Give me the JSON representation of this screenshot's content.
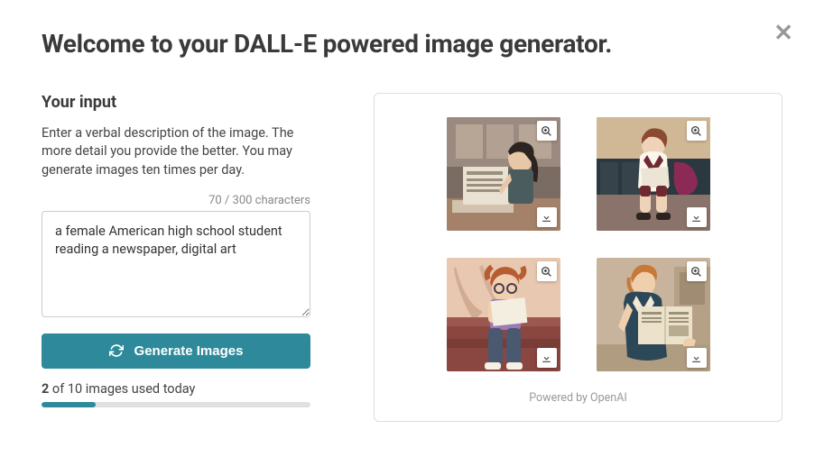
{
  "header": {
    "title": "Welcome to your DALL-E powered image generator."
  },
  "input": {
    "section_title": "Your input",
    "description": "Enter a verbal description of the image. The more detail you provide the better. You may generate images ten times per day.",
    "char_count": "70 / 300 characters",
    "prompt_value": "a female American high school student reading a newspaper, digital art"
  },
  "generate_button": {
    "label": "Generate Images"
  },
  "usage": {
    "used": "2",
    "rest": " of 10 images used today",
    "percent": 20
  },
  "footer": {
    "powered_by": "Powered by OpenAI"
  },
  "results": [
    {
      "alt": "Generated image 1"
    },
    {
      "alt": "Generated image 2"
    },
    {
      "alt": "Generated image 3"
    },
    {
      "alt": "Generated image 4"
    }
  ]
}
